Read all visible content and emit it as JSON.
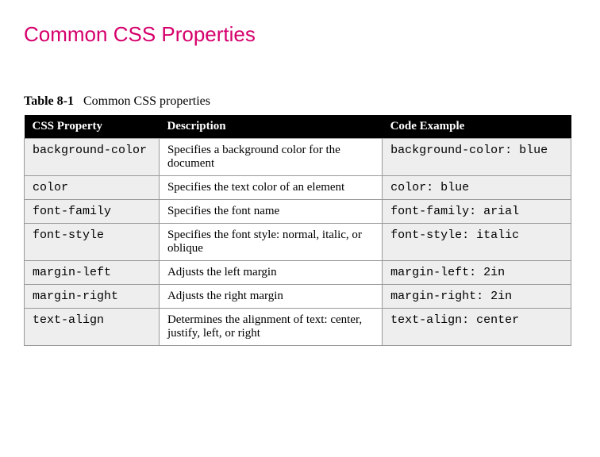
{
  "page": {
    "title": "Common CSS Properties"
  },
  "table": {
    "label_prefix": "Table 8-1",
    "label_text": "Common CSS properties",
    "headers": {
      "property": "CSS Property",
      "description": "Description",
      "code": "Code Example"
    },
    "rows": [
      {
        "property": "background-color",
        "description": "Specifies a background color for the document",
        "code": "background-color: blue"
      },
      {
        "property": "color",
        "description": "Specifies the text color of an element",
        "code": "color: blue"
      },
      {
        "property": "font-family",
        "description": "Specifies the font name",
        "code": "font-family: arial"
      },
      {
        "property": "font-style",
        "description": "Specifies the font style: normal, italic, or oblique",
        "code": "font-style: italic"
      },
      {
        "property": "margin-left",
        "description": "Adjusts the left margin",
        "code": "margin-left: 2in"
      },
      {
        "property": "margin-right",
        "description": "Adjusts the right margin",
        "code": "margin-right: 2in"
      },
      {
        "property": "text-align",
        "description": "Determines the alignment of text: center, justify, left, or right",
        "code": "text-align: center"
      }
    ]
  }
}
